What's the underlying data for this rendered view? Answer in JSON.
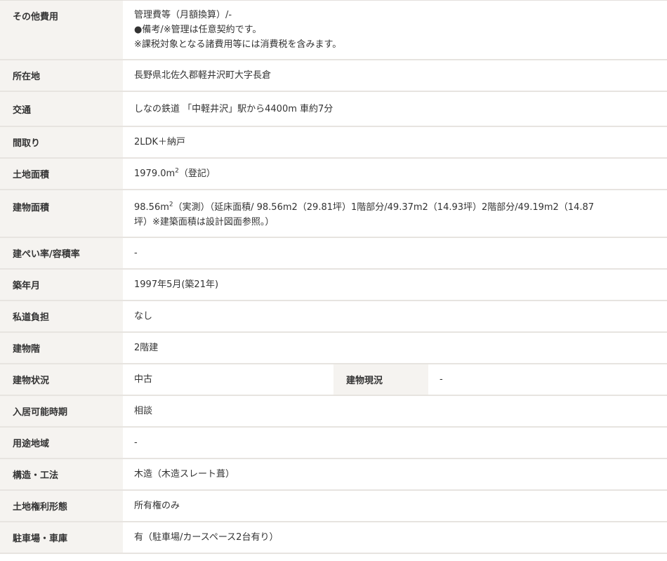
{
  "rows": [
    {
      "label": "その他費用",
      "lines": [
        "管理費等（月額換算）/-",
        "●備考/※管理は任意契約です。",
        "※課税対象となる諸費用等には消費税を含みます。"
      ]
    },
    {
      "label": "所在地",
      "value": "長野県北佐久郡軽井沢町大字長倉"
    },
    {
      "label": "交通",
      "value": "しなの鉄道 「中軽井沢」駅から4400m 車約7分"
    },
    {
      "label": "間取り",
      "value": "2LDK＋納戸"
    },
    {
      "label": "土地面積",
      "value_main": "1979.0m",
      "value_sup": "2",
      "value_rest": "（登記）"
    },
    {
      "label": "建物面積",
      "value_main": "98.56m",
      "value_sup": "2",
      "value_rest": "（実測）（延床面積/ 98.56m2（29.81坪）1階部分/49.37m2（14.93坪）2階部分/49.19m2（14.87",
      "value_line2": "坪）※建築面積は設計図面参照。）"
    },
    {
      "label": "建ぺい率/容積率",
      "value": "-"
    },
    {
      "label": "築年月",
      "value": "1997年5月(築21年)"
    },
    {
      "label": "私道負担",
      "value": "なし"
    },
    {
      "label": "建物階",
      "value": "2階建"
    },
    {
      "label": "建物状況",
      "value": "中古",
      "label2": "建物現況",
      "value2": "-"
    },
    {
      "label": "入居可能時期",
      "value": "相談"
    },
    {
      "label": "用途地域",
      "value": "-"
    },
    {
      "label": "構造・工法",
      "value": "木造（木造スレート葺）"
    },
    {
      "label": "土地権利形態",
      "value": "所有権のみ"
    },
    {
      "label": "駐車場・車庫",
      "value": "有（駐車場/カースペース2台有り）"
    }
  ]
}
